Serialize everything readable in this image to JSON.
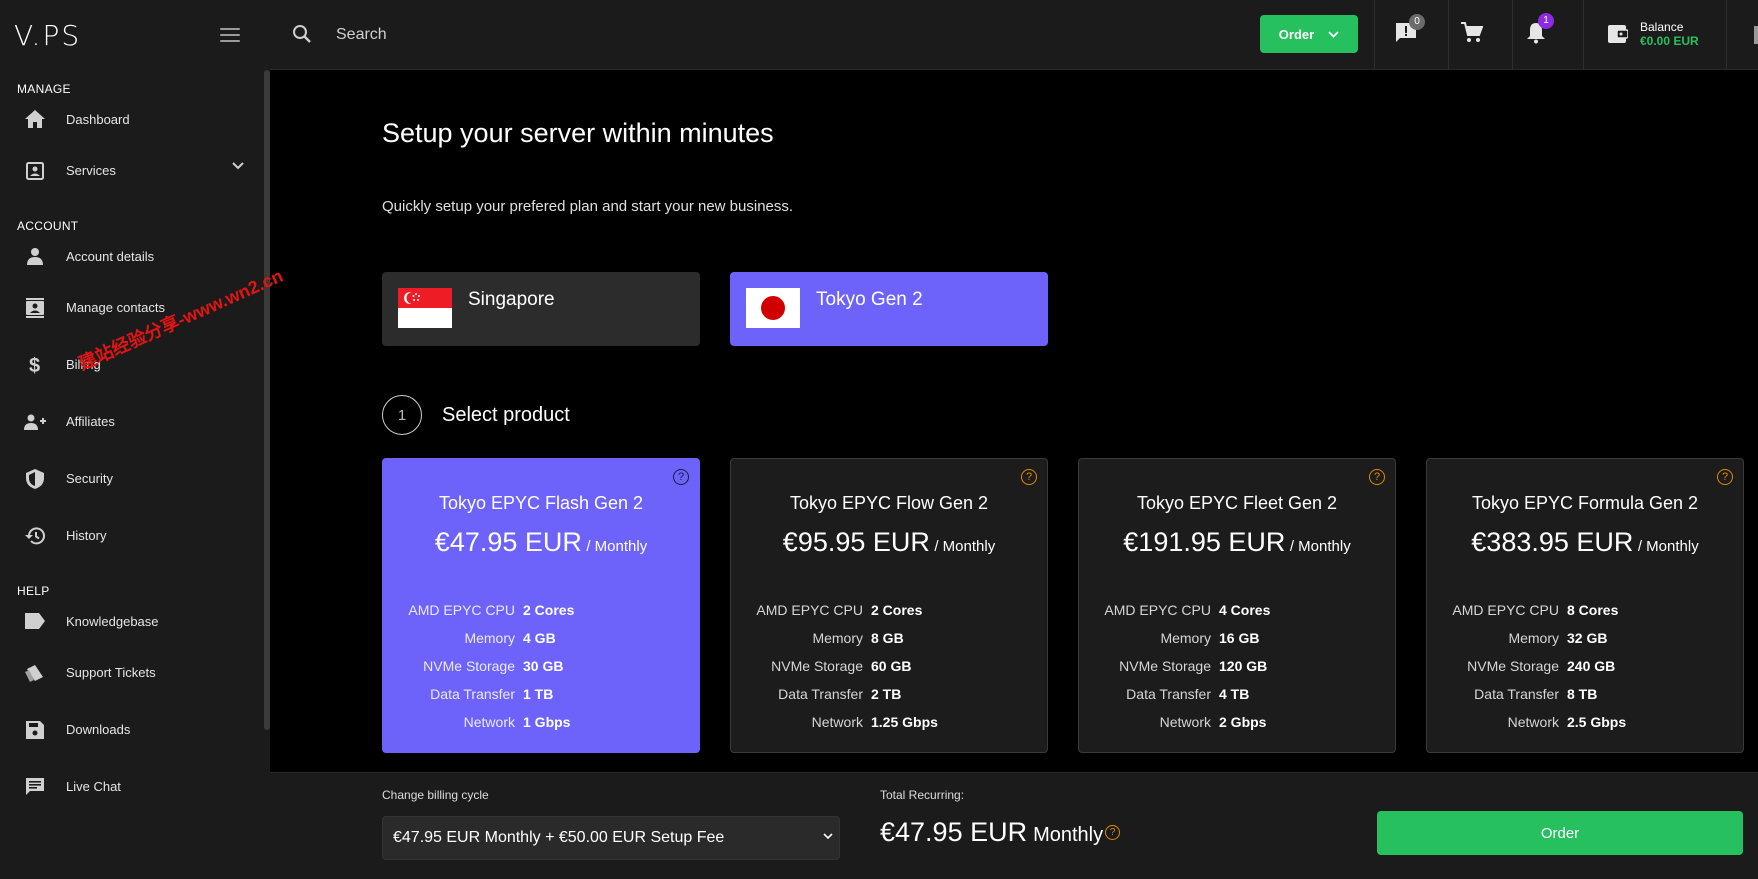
{
  "sidebar": {
    "logo": "V.PS",
    "sections": {
      "manage": "MANAGE",
      "account": "ACCOUNT",
      "help": "HELP"
    },
    "items": {
      "dashboard": "Dashboard",
      "services": "Services",
      "account_details": "Account details",
      "manage_contacts": "Manage contacts",
      "billing": "Billing",
      "affiliates": "Affiliates",
      "security": "Security",
      "history": "History",
      "knowledgebase": "Knowledgebase",
      "support_tickets": "Support Tickets",
      "downloads": "Downloads",
      "live_chat": "Live Chat"
    }
  },
  "topbar": {
    "search_placeholder": "Search",
    "order_label": "Order",
    "tickets_badge": "0",
    "notifications_badge": "1",
    "balance_label": "Balance",
    "balance_value": "€0.00 EUR"
  },
  "main": {
    "title": "Setup your server within minutes",
    "subtitle": "Quickly setup your prefered plan and start your new business.",
    "locations": [
      {
        "name": "Singapore",
        "selected": false
      },
      {
        "name": "Tokyo Gen 2",
        "selected": true
      }
    ],
    "step": {
      "number": "1",
      "label": "Select product"
    },
    "products": [
      {
        "name": "Tokyo EPYC Flash Gen 2",
        "price": "€47.95 EUR",
        "period": "/ Monthly",
        "selected": true,
        "specs": [
          {
            "k": "AMD EPYC CPU",
            "v": "2 Cores"
          },
          {
            "k": "Memory",
            "v": "4 GB"
          },
          {
            "k": "NVMe Storage",
            "v": "30 GB"
          },
          {
            "k": "Data Transfer",
            "v": "1 TB"
          },
          {
            "k": "Network",
            "v": "1 Gbps"
          }
        ]
      },
      {
        "name": "Tokyo EPYC Flow Gen 2",
        "price": "€95.95 EUR",
        "period": "/ Monthly",
        "selected": false,
        "specs": [
          {
            "k": "AMD EPYC CPU",
            "v": "2 Cores"
          },
          {
            "k": "Memory",
            "v": "8 GB"
          },
          {
            "k": "NVMe Storage",
            "v": "60 GB"
          },
          {
            "k": "Data Transfer",
            "v": "2 TB"
          },
          {
            "k": "Network",
            "v": "1.25 Gbps"
          }
        ]
      },
      {
        "name": "Tokyo EPYC Fleet Gen 2",
        "price": "€191.95 EUR",
        "period": "/ Monthly",
        "selected": false,
        "specs": [
          {
            "k": "AMD EPYC CPU",
            "v": "4 Cores"
          },
          {
            "k": "Memory",
            "v": "16 GB"
          },
          {
            "k": "NVMe Storage",
            "v": "120 GB"
          },
          {
            "k": "Data Transfer",
            "v": "4 TB"
          },
          {
            "k": "Network",
            "v": "2 Gbps"
          }
        ]
      },
      {
        "name": "Tokyo EPYC Formula Gen 2",
        "price": "€383.95 EUR",
        "period": "/ Monthly",
        "selected": false,
        "specs": [
          {
            "k": "AMD EPYC CPU",
            "v": "8 Cores"
          },
          {
            "k": "Memory",
            "v": "32 GB"
          },
          {
            "k": "NVMe Storage",
            "v": "240 GB"
          },
          {
            "k": "Data Transfer",
            "v": "8 TB"
          },
          {
            "k": "Network",
            "v": "2.5 Gbps"
          }
        ]
      }
    ]
  },
  "bottombar": {
    "billing_label": "Change billing cycle",
    "billing_value": "€47.95 EUR Monthly + €50.00 EUR Setup Fee",
    "total_label": "Total Recurring:",
    "total_amount": "€47.95 EUR",
    "total_period": "Monthly",
    "order_label": "Order"
  },
  "watermark": "建站经验分享-www.wn2.cn",
  "colors": {
    "accent": "#6d63fa",
    "green": "#27c05f",
    "sidebar_bg": "#1b1b1b",
    "help_orange": "#e08a00"
  }
}
